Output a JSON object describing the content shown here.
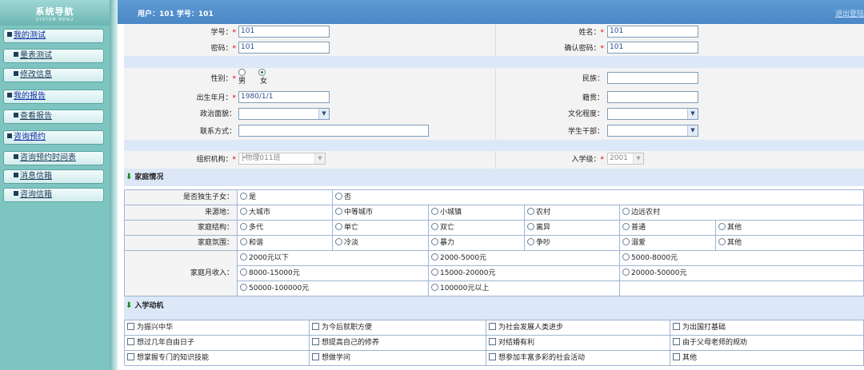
{
  "sidebar": {
    "title": "系统导航",
    "subtitle": "SYSTEM MENU",
    "items": [
      {
        "label": "我的测试"
      },
      {
        "label": "量表测试"
      },
      {
        "label": "修改信息"
      },
      {
        "label": "我的报告"
      },
      {
        "label": "查看报告"
      },
      {
        "label": "咨询预约"
      },
      {
        "label": "咨询预约时间表"
      },
      {
        "label": "消息信箱"
      },
      {
        "label": "咨询信箱"
      }
    ]
  },
  "header": {
    "user_info": "用户：101   学号：101",
    "logout": "退出登陆"
  },
  "form": {
    "student_id": {
      "label": "学号：",
      "value": "101"
    },
    "name": {
      "label": "姓名：",
      "value": "101"
    },
    "password": {
      "label": "密码：",
      "value": "101"
    },
    "confirm_password": {
      "label": "确认密码：",
      "value": "101"
    },
    "gender": {
      "label": "性别：",
      "male": "男",
      "female": "女",
      "selected": "女"
    },
    "ethnicity": {
      "label": "民族：",
      "value": ""
    },
    "birth": {
      "label": "出生年月：",
      "value": "1980/1/1"
    },
    "native_place": {
      "label": "籍贯：",
      "value": ""
    },
    "political": {
      "label": "政治面貌：",
      "value": ""
    },
    "education": {
      "label": "文化程度：",
      "value": ""
    },
    "contact": {
      "label": "联系方式：",
      "value": ""
    },
    "student_cadre": {
      "label": "学生干部：",
      "value": ""
    },
    "org": {
      "label": "组织机构：",
      "value": "┝物理011班"
    },
    "enroll_year": {
      "label": "入学级：",
      "value": "2001"
    },
    "required_mark": "*"
  },
  "family": {
    "section_title": "家庭情况",
    "only_child": {
      "label": "是否独生子女：",
      "options": [
        "是",
        "否"
      ]
    },
    "origin": {
      "label": "来源地：",
      "options": [
        "大城市",
        "中等城市",
        "小城镇",
        "农村",
        "边远农村"
      ]
    },
    "structure": {
      "label": "家庭结构：",
      "options": [
        "多代",
        "单亡",
        "双亡",
        "离异",
        "普通",
        "其他"
      ]
    },
    "atmosphere": {
      "label": "家庭氛围：",
      "options": [
        "和谐",
        "冷淡",
        "暴力",
        "争吵",
        "溺爱",
        "其他"
      ]
    },
    "income": {
      "label": "家庭月收入：",
      "options": [
        "2000元以下",
        "2000-5000元",
        "5000-8000元",
        "8000-15000元",
        "15000-20000元",
        "20000-50000元",
        "50000-100000元",
        "100000元以上"
      ]
    }
  },
  "motivation": {
    "section_title": "入学动机",
    "options": [
      "为振兴中华",
      "为今后就职方便",
      "为社会发展人类进步",
      "为出国打基础",
      "想过几年自由日子",
      "想提高自己的修养",
      "对结婚有利",
      "由于父母老师的规劝",
      "想掌握专门的知识技能",
      "想做学问",
      "想参加丰富多彩的社会活动",
      "其他"
    ]
  },
  "colors": {
    "sidebar": "#7ec5c2",
    "header": "#4a87c6",
    "band": "#dce7f7",
    "link": "#0a2aa0"
  }
}
